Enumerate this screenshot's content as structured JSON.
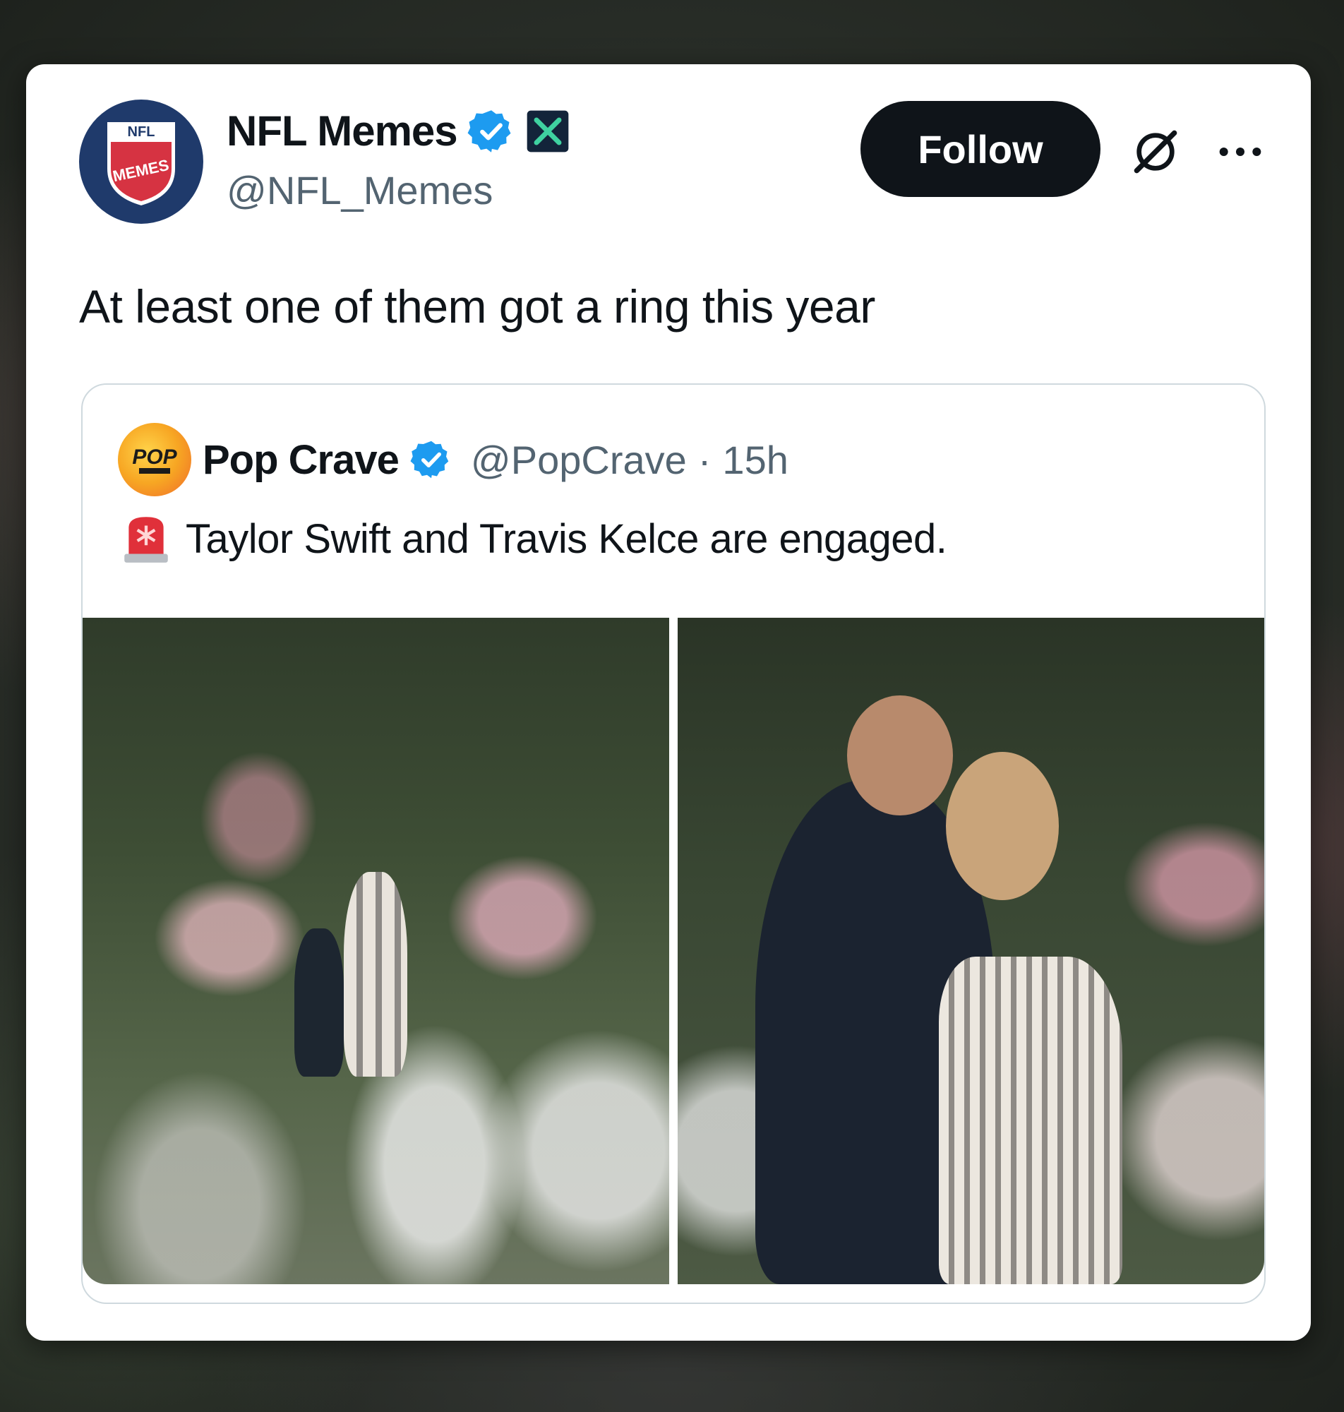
{
  "tweet": {
    "author_name": "NFL Memes",
    "author_handle": "@NFL_Memes",
    "follow_label": "Follow",
    "text": "At least one of them got a ring this year",
    "avatar_logo_top": "NFL",
    "avatar_logo_main": "MEMES",
    "verified_color": "#1d9bf0",
    "affiliate_icon": "x-logo-icon",
    "icons": [
      "grok-icon",
      "more-icon"
    ]
  },
  "quote": {
    "author_name": "Pop Crave",
    "author_handle": "@PopCrave",
    "separator": "·",
    "time": "15h",
    "avatar_logo": "POP",
    "emoji_icon": "siren-icon",
    "text": "Taylor Swift and Travis Kelce are engaged.",
    "media_count": 2
  },
  "colors": {
    "text_primary": "#0f1419",
    "text_secondary": "#536471",
    "follow_bg": "#0f1419",
    "border": "#cfd9de",
    "nfl_blue": "#1f3a6b",
    "siren_red": "#e0303a"
  }
}
